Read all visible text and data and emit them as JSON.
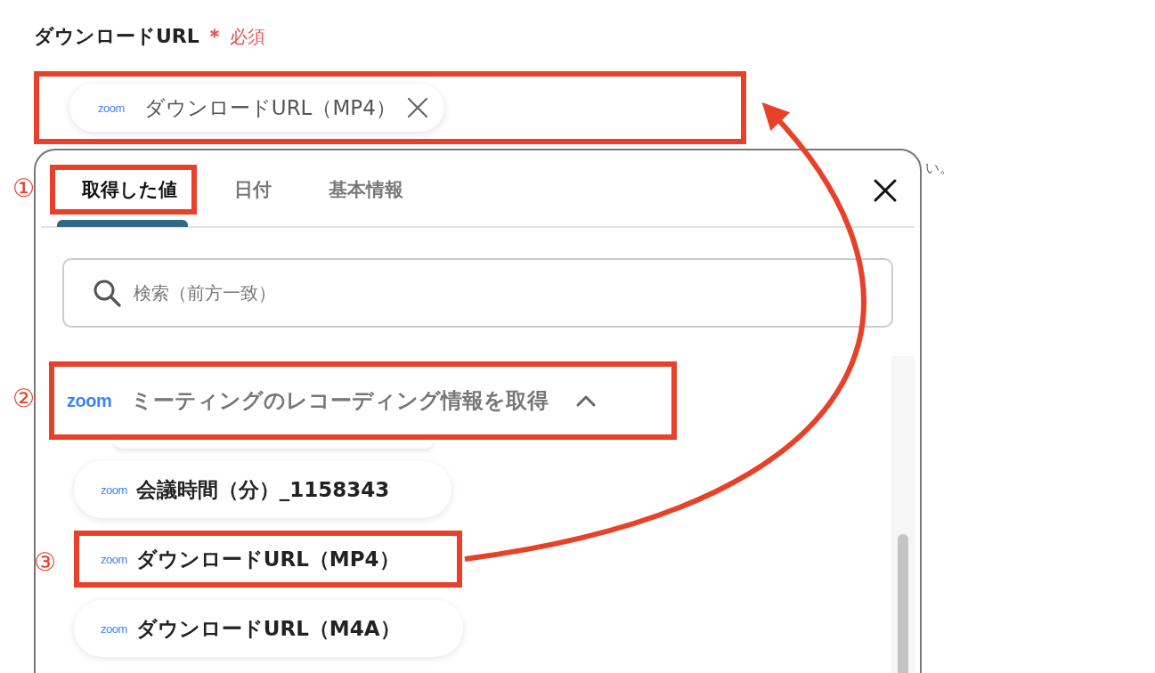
{
  "field": {
    "label": "ダウンロードURL",
    "required_mark": "＊",
    "required_text": "必須",
    "highlighted": true,
    "chip": {
      "logo": "zoom",
      "text": "ダウンロードURL（MP4）"
    }
  },
  "hint_fragment": "い。",
  "picker": {
    "tabs": [
      {
        "label": "取得した値",
        "selected": true,
        "highlighted": true
      },
      {
        "label": "日付",
        "selected": false,
        "highlighted": false
      },
      {
        "label": "基本情報",
        "selected": false,
        "highlighted": false
      }
    ],
    "search": {
      "placeholder": "検索（前方一致）"
    },
    "section": {
      "logo": "zoom",
      "title": "ミーティングのレコーディング情報を取得",
      "expanded": true,
      "highlighted": true
    },
    "items": [
      {
        "logo": "zoom",
        "text": "会議時間（分）_1158343",
        "highlighted": false
      },
      {
        "logo": "zoom",
        "text": "ダウンロードURL（MP4）",
        "highlighted": true
      },
      {
        "logo": "zoom",
        "text": "ダウンロードURL（M4A）",
        "highlighted": false
      }
    ]
  },
  "annotations": {
    "markers": [
      "①",
      "②",
      "③"
    ]
  }
}
